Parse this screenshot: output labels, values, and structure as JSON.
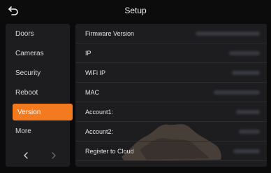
{
  "header": {
    "title": "Setup",
    "back_icon": "back-arrow-icon"
  },
  "sidebar": {
    "items": [
      {
        "label": "Doors",
        "active": false
      },
      {
        "label": "Cameras",
        "active": false
      },
      {
        "label": "Security",
        "active": false
      },
      {
        "label": "Reboot",
        "active": false
      },
      {
        "label": "Version",
        "active": true
      },
      {
        "label": "More",
        "active": false
      }
    ],
    "prev_icon": "chevron-left-icon",
    "next_icon": "chevron-right-icon"
  },
  "version_info": {
    "rows": [
      {
        "label": "Firmware Version"
      },
      {
        "label": "IP"
      },
      {
        "label": "WiFi IP"
      },
      {
        "label": "MAC"
      },
      {
        "label": "Account1:"
      },
      {
        "label": "Account2:"
      },
      {
        "label": "Register to Cloud"
      }
    ]
  },
  "colors": {
    "accent": "#f47a20",
    "panel": "#1d1d20",
    "background": "#0a0a0b"
  }
}
